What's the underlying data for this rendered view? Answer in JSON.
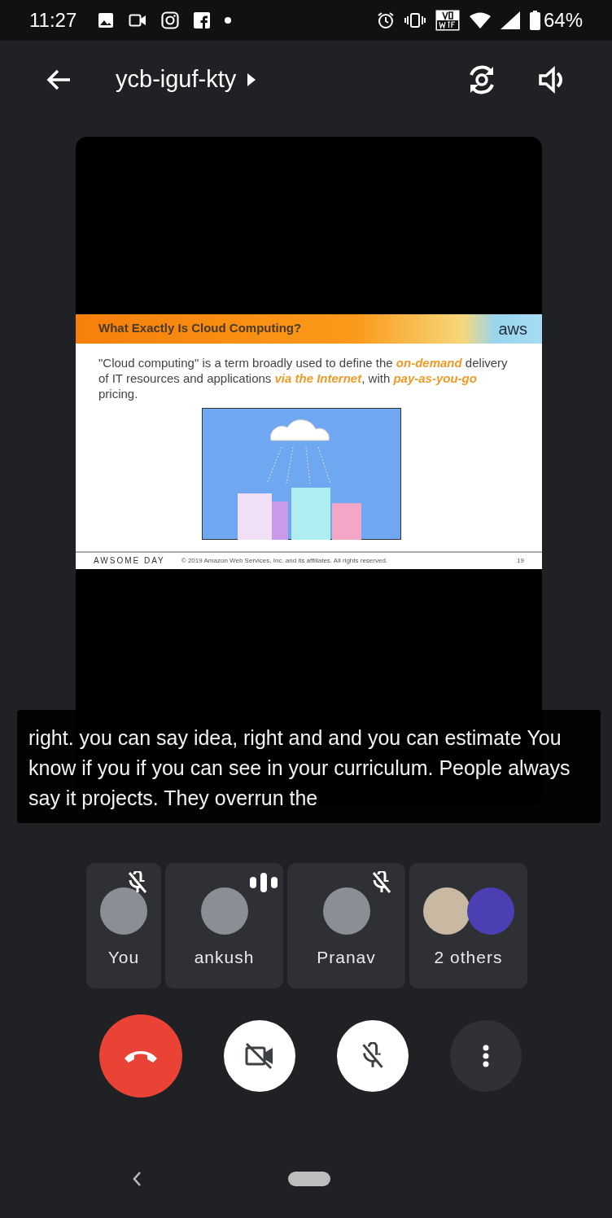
{
  "status_bar": {
    "time": "11:27",
    "battery": "64%"
  },
  "app_bar": {
    "title": "ycb-iguf-kty"
  },
  "slide": {
    "title": "What Exactly Is Cloud Computing?",
    "logo": "aws",
    "body": "\"Cloud computing\" is a term broadly used to define the *on-demand* delivery of IT resources and applications *via the Internet*, with *pay-as-you-go* pricing.",
    "brand": "AWSOME DAY",
    "copyright": "© 2019 Amazon Web Services, Inc. and its affiliates. All rights reserved.",
    "page": "19"
  },
  "caption": "right. you can say idea, right and and you can estimate You know if you if you can see in your curriculum. People always say it projects. They overrun the",
  "participants": [
    {
      "name": "You",
      "kind": "single",
      "muted": true,
      "speaking": false
    },
    {
      "name": "ankush",
      "kind": "single",
      "muted": false,
      "speaking": true
    },
    {
      "name": "Pranav",
      "kind": "single",
      "muted": true,
      "speaking": false
    },
    {
      "name": "2 others",
      "kind": "group",
      "muted": false,
      "speaking": false
    }
  ],
  "controls": {
    "camera_on": false,
    "mic_on": false
  }
}
